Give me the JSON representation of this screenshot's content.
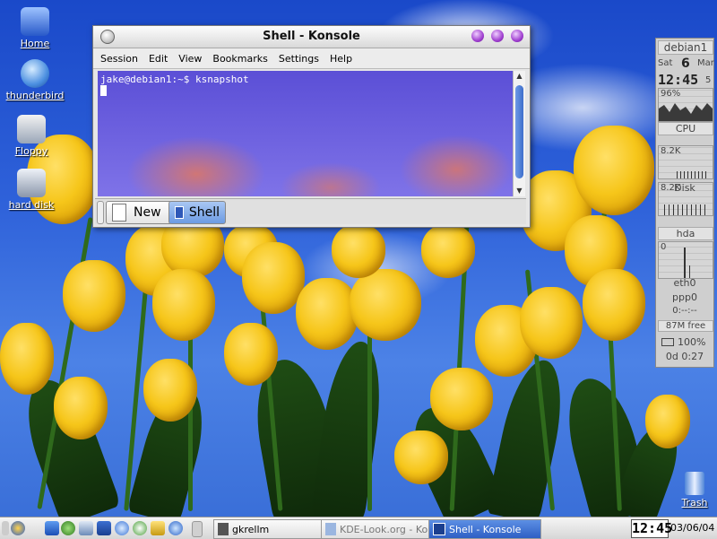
{
  "desktop": {
    "icons": [
      {
        "label": "Home"
      },
      {
        "label": "thunderbird"
      },
      {
        "label": "Floppy"
      },
      {
        "label": "hard disk"
      }
    ],
    "trash_label": "Trash"
  },
  "konsole": {
    "title": "Shell - Konsole",
    "menu": [
      "Session",
      "Edit",
      "View",
      "Bookmarks",
      "Settings",
      "Help"
    ],
    "prompt_line": "jake@debian1:~$ ksnapshot",
    "new_tab_label": "New",
    "shell_tab_label": "Shell"
  },
  "gkrellm": {
    "hostname": "debian1",
    "day": "Sat",
    "date_num": "6",
    "month": "Mar",
    "time": "12:45",
    "seconds": "5",
    "cpu_percent": "96%",
    "cpu_label": "CPU",
    "proc_value_1": "8.2K",
    "proc_value_2": "8.2K",
    "disk_label": "Disk",
    "hda_label": "hda",
    "hda_value": "0",
    "eth_label": "eth0",
    "ppp_label": "ppp0",
    "ppp_time": "0:--:--",
    "mem_label": "87M free",
    "battery": "100%",
    "uptime": "0d  0:27"
  },
  "taskbar": {
    "tasks": [
      {
        "label": "gkrellm"
      },
      {
        "label": "KDE-Look.org - Ko"
      },
      {
        "label": "Shell - Konsole"
      }
    ],
    "clock": "12:45",
    "date": "03/06/04"
  },
  "colors": {
    "sky": "#2f62da",
    "terminal_bg": "#6a5fe0",
    "active_task": "#3b6fd1",
    "tulip": "#f6c61a"
  }
}
